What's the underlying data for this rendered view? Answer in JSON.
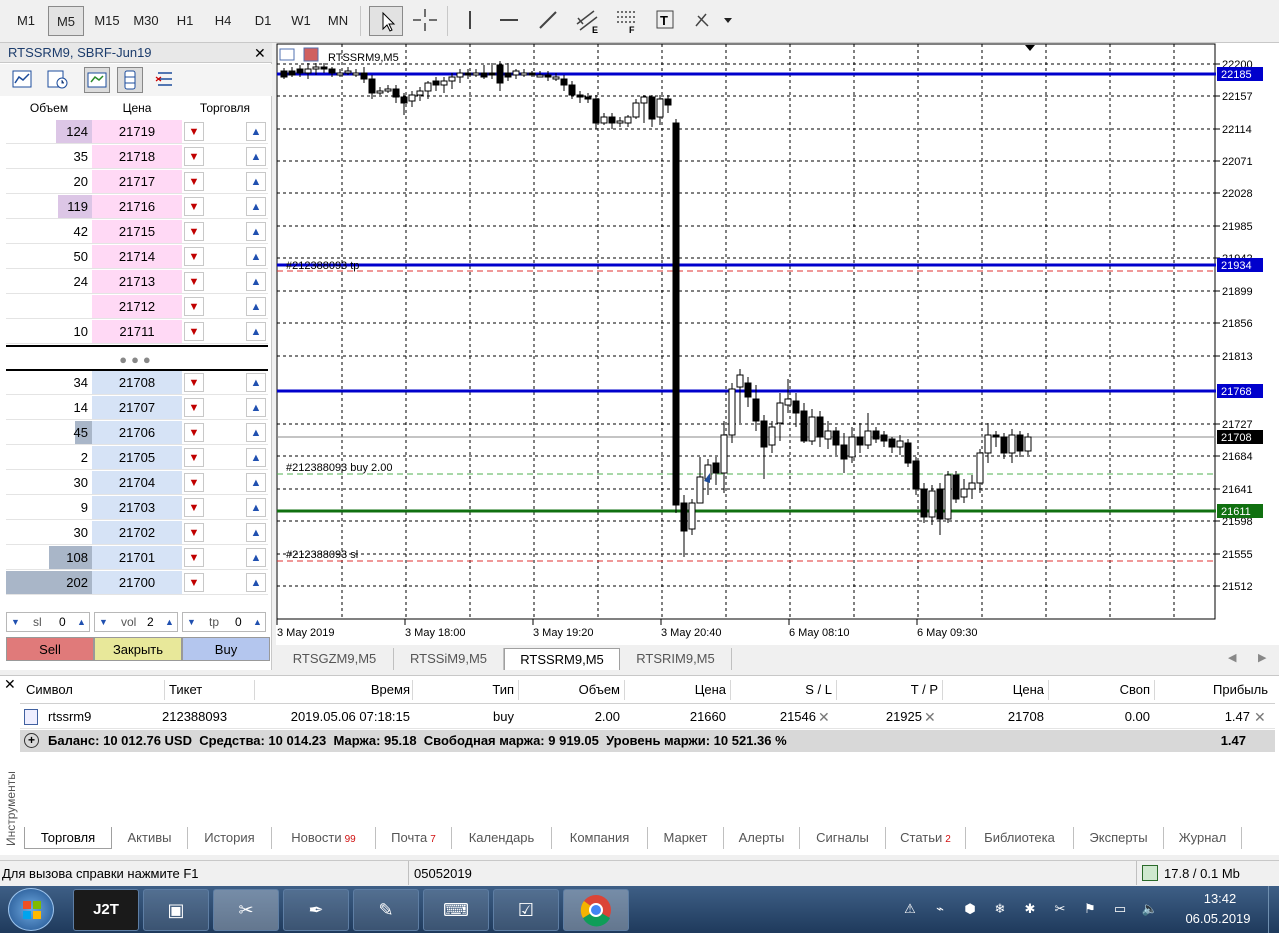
{
  "toolbar": {
    "timeframes": [
      "M1",
      "M5",
      "M15",
      "M30",
      "H1",
      "H4",
      "D1",
      "W1",
      "MN"
    ],
    "selected_timeframe": "M5",
    "tools": [
      "cursor-icon",
      "crosshair-icon",
      "vertical-line-icon",
      "horizontal-line-icon",
      "trend-line-icon",
      "equidistant-channel-icon",
      "fibonacci-icon",
      "text-icon",
      "shapes-icon"
    ]
  },
  "dom": {
    "title": "RTSSRM9, SBRF-Jun19",
    "headers": {
      "volume": "Объем",
      "price": "Цена",
      "trade": "Торговля"
    },
    "asks": [
      {
        "vol": "124",
        "price": "21719",
        "bar": 0.42
      },
      {
        "vol": "35",
        "price": "21718",
        "bar": 0
      },
      {
        "vol": "20",
        "price": "21717",
        "bar": 0
      },
      {
        "vol": "119",
        "price": "21716",
        "bar": 0.4
      },
      {
        "vol": "42",
        "price": "21715",
        "bar": 0
      },
      {
        "vol": "50",
        "price": "21714",
        "bar": 0
      },
      {
        "vol": "24",
        "price": "21713",
        "bar": 0
      },
      {
        "vol": "",
        "price": "21712",
        "bar": 0
      },
      {
        "vol": "10",
        "price": "21711",
        "bar": 0
      }
    ],
    "bids": [
      {
        "vol": "34",
        "price": "21708",
        "bar": 0
      },
      {
        "vol": "14",
        "price": "21707",
        "bar": 0
      },
      {
        "vol": "45",
        "price": "21706",
        "bar": 0.2
      },
      {
        "vol": "2",
        "price": "21705",
        "bar": 0
      },
      {
        "vol": "30",
        "price": "21704",
        "bar": 0
      },
      {
        "vol": "9",
        "price": "21703",
        "bar": 0
      },
      {
        "vol": "30",
        "price": "21702",
        "bar": 0
      },
      {
        "vol": "108",
        "price": "21701",
        "bar": 0.5
      },
      {
        "vol": "202",
        "price": "21700",
        "bar": 1.0
      }
    ],
    "sl_label": "sl",
    "sl_value": "0",
    "vol_label": "vol",
    "vol_value": "2",
    "tp_label": "tp",
    "tp_value": "0",
    "sell_label": "Sell",
    "close_label": "Закрыть",
    "buy_label": "Buy",
    "colors": {
      "ask_price_bg": "#ffd9f5",
      "bid_price_bg": "#d6e3f6",
      "sell": "#e07a7a",
      "close": "#e8e89a",
      "buy": "#b4c6ee"
    }
  },
  "chart": {
    "symbol_label": "RTSSRM9,M5",
    "price_labels": [
      "22200",
      "22157",
      "22114",
      "22071",
      "22028",
      "21985",
      "21942",
      "21899",
      "21856",
      "21813",
      "21727",
      "21684",
      "21641",
      "21598",
      "21555",
      "21512"
    ],
    "level_tags": {
      "resistance": "22185",
      "tp": "21934",
      "mid": "21768",
      "current": "21708",
      "support": "21611"
    },
    "order_labels": {
      "tp": "#212388093 tp",
      "buy": "#212388093 buy 2.00",
      "sl": "#212388093 sl"
    },
    "time_labels": [
      "3 May 2019",
      "3 May 18:00",
      "3 May 19:20",
      "3 May 20:40",
      "6 May 08:10",
      "6 May 09:30"
    ],
    "colors": {
      "blue_line": "#0000cc",
      "green_line": "#107010",
      "red_dash": "#e03030",
      "green_dash": "#50b050",
      "grid": "#000000"
    }
  },
  "chart_tabs": [
    "RTSGZM9,M5",
    "RTSSiM9,M5",
    "RTSSRM9,M5",
    "RTSRIM9,M5"
  ],
  "active_chart_tab": "RTSSRM9,M5",
  "terminal": {
    "side_label": "Инструменты",
    "columns": [
      "Символ",
      "Тикет",
      "Время",
      "Тип",
      "Объем",
      "Цена",
      "S / L",
      "T / P",
      "Цена",
      "Своп",
      "Прибыль"
    ],
    "position": {
      "symbol": "rtssrm9",
      "ticket": "212388093",
      "time": "2019.05.06 07:18:15",
      "type": "buy",
      "volume": "2.00",
      "price": "21660",
      "sl": "21546",
      "tp": "21925",
      "cur_price": "21708",
      "swap": "0.00",
      "profit": "1.47"
    },
    "summary": "Баланс: 10 012.76 USD  Средства: 10 014.23  Маржа: 95.18  Свободная маржа: 9 919.05  Уровень маржи: 10 521.36 %",
    "summary_profit": "1.47",
    "tabs": [
      {
        "label": "Торговля",
        "badge": ""
      },
      {
        "label": "Активы",
        "badge": ""
      },
      {
        "label": "История",
        "badge": ""
      },
      {
        "label": "Новости",
        "badge": "99"
      },
      {
        "label": "Почта",
        "badge": "7"
      },
      {
        "label": "Календарь",
        "badge": ""
      },
      {
        "label": "Компания",
        "badge": ""
      },
      {
        "label": "Маркет",
        "badge": ""
      },
      {
        "label": "Алерты",
        "badge": ""
      },
      {
        "label": "Сигналы",
        "badge": ""
      },
      {
        "label": "Статьи",
        "badge": "2"
      },
      {
        "label": "Библиотека",
        "badge": ""
      },
      {
        "label": "Эксперты",
        "badge": ""
      },
      {
        "label": "Журнал",
        "badge": ""
      }
    ]
  },
  "status": {
    "help": "Для вызова справки нажмите F1",
    "profile": "05052019",
    "traffic": "17.8 / 0.1 Mb"
  },
  "taskbar": {
    "time": "13:42",
    "date": "06.05.2019",
    "j2t_label": "J2T"
  }
}
